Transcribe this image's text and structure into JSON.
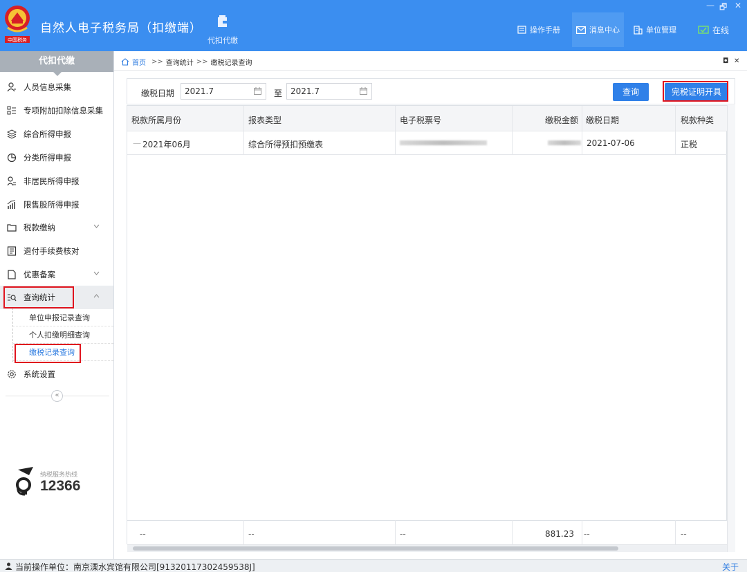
{
  "app": {
    "title": "自然人电子税务局（扣缴端）",
    "module_tab": "代扣代缴",
    "window_controls": {
      "minimize": "—",
      "restore": "🗗",
      "close": "✕"
    }
  },
  "header_nav": [
    {
      "label": "操作手册",
      "icon": "manual-icon"
    },
    {
      "label": "消息中心",
      "icon": "mail-icon"
    },
    {
      "label": "单位管理",
      "icon": "building-icon"
    },
    {
      "label": "在线",
      "icon": "online-icon"
    }
  ],
  "sidebar": {
    "title": "代扣代缴",
    "items": [
      {
        "label": "人员信息采集",
        "icon": "person-icon"
      },
      {
        "label": "专项附加扣除信息采集",
        "icon": "list-icon"
      },
      {
        "label": "综合所得申报",
        "icon": "layers-icon"
      },
      {
        "label": "分类所得申报",
        "icon": "pie-icon"
      },
      {
        "label": "非居民所得申报",
        "icon": "nonresident-icon"
      },
      {
        "label": "限售股所得申报",
        "icon": "bar-icon"
      },
      {
        "label": "税款缴纳",
        "icon": "folder-icon"
      },
      {
        "label": "退付手续费核对",
        "icon": "doc-check-icon"
      },
      {
        "label": "优惠备案",
        "icon": "file-icon"
      },
      {
        "label": "查询统计",
        "icon": "query-icon"
      },
      {
        "label": "系统设置",
        "icon": "gear-icon"
      }
    ],
    "sub_items": [
      "单位申报记录查询",
      "个人扣缴明细查询",
      "缴税记录查询"
    ],
    "collapse_glyph": "«",
    "hotline_label": "纳税服务热线",
    "hotline_number": "12366"
  },
  "breadcrumb": {
    "home": "首页",
    "sep": ">>",
    "level2": "查询统计",
    "current": "缴税记录查询",
    "restore": "◘",
    "close": "✕"
  },
  "filter": {
    "date_label": "缴税日期",
    "from": "2021.7",
    "to_label": "至",
    "to": "2021.7",
    "query_button": "查询",
    "certificate_button": "完税证明开具"
  },
  "table": {
    "columns": [
      "税款所属月份",
      "报表类型",
      "电子税票号",
      "缴税金额",
      "缴税日期",
      "税款种类"
    ],
    "rows": [
      {
        "month": "2021年06月",
        "report_type": "综合所得预扣预缴表",
        "ticket_no": "",
        "amount": "",
        "date": "2021-07-06",
        "tax_type": "正税"
      }
    ],
    "totals": [
      "--",
      "--",
      "--",
      "881.23",
      "--",
      "--"
    ]
  },
  "status": {
    "text": "当前操作单位：南京溧水宾馆有限公司[91320117302459538J]",
    "about": "关于"
  },
  "colors": {
    "header_blue": "#3b8ef0",
    "accent_blue": "#2f80e8",
    "highlight_red": "#e0141e"
  }
}
